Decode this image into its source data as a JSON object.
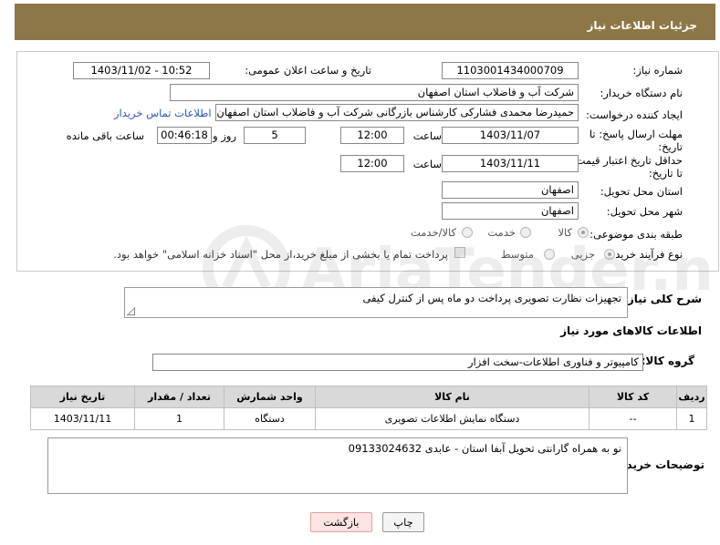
{
  "header": {
    "title": "جزئیات اطلاعات نیاز"
  },
  "form": {
    "need_number": {
      "label": "شماره نیاز:",
      "value": "1103001434000709"
    },
    "announce_datetime": {
      "label": "تاریخ و ساعت اعلان عمومی:",
      "value": "1403/11/02 - 10:52"
    },
    "buyer_org": {
      "label": "نام دستگاه خریدار:",
      "value": "شرکت آب و فاضلاب استان اصفهان"
    },
    "requester": {
      "label": "ایجاد کننده درخواست:",
      "value": "حمیدرضا محمدی فشارکی کارشناس بازرگانی شرکت آب و فاضلاب استان اصفهان",
      "contact_link": "اطلاعات تماس خریدار"
    },
    "response_deadline": {
      "label": "مهلت ارسال پاسخ: تا تاریخ:",
      "date": "1403/11/07",
      "time_label": "ساعت",
      "time": "12:00",
      "days": "5",
      "days_label": "روز و",
      "remaining": "00:46:18",
      "remaining_label": "ساعت باقی مانده"
    },
    "price_validity": {
      "label": "حداقل تاریخ اعتبار قیمت: تا تاریخ:",
      "date": "1403/11/11",
      "time_label": "ساعت",
      "time": "12:00"
    },
    "delivery_province": {
      "label": "استان محل تحویل:",
      "value": "اصفهان"
    },
    "delivery_city": {
      "label": "شهر محل تحویل:",
      "value": "اصفهان"
    },
    "category": {
      "label": "طبقه بندی موضوعی:",
      "options": [
        "کالا",
        "خدمت",
        "کالا/خدمت"
      ],
      "selected": "کالا"
    },
    "purchase_type": {
      "label": "نوع فرآیند خرید :",
      "options": [
        "جزیی",
        "متوسط"
      ],
      "selected": "جزیی",
      "payment_note": "پرداخت تمام یا بخشی از مبلغ خرید،از محل \"اسناد خزانه اسلامی\" خواهد بود."
    }
  },
  "description": {
    "label": "شرح کلی نیاز:",
    "value": "تجهیزات نظارت تصویری پرداخت دو ماه پس از کنترل کیفی"
  },
  "goods_section": {
    "title": "اطلاعات کالاهای مورد نیاز",
    "group_label": "گروه کالا:",
    "group_value": "کامپیوتر و فناوری اطلاعات-سخت افزار"
  },
  "table": {
    "headers": [
      "ردیف",
      "کد کالا",
      "نام کالا",
      "واحد شمارش",
      "تعداد / مقدار",
      "تاریخ نیاز"
    ],
    "rows": [
      [
        "1",
        "--",
        "دستگاه نمایش اطلاعات تصویری",
        "دستگاه",
        "1",
        "1403/11/11"
      ]
    ]
  },
  "buyer_notes": {
    "label": "توضیحات خریدار:",
    "value": "نو به همراه گارانتی تحویل آبفا استان - عابدی 09133024632"
  },
  "buttons": {
    "print": "چاپ",
    "back": "بازگشت"
  },
  "watermark": {
    "text": "AriaTender.neT"
  },
  "colors": {
    "header_bg": "#8e7747",
    "link": "#2a55c0",
    "back_button_bg": "#fde3e3"
  }
}
